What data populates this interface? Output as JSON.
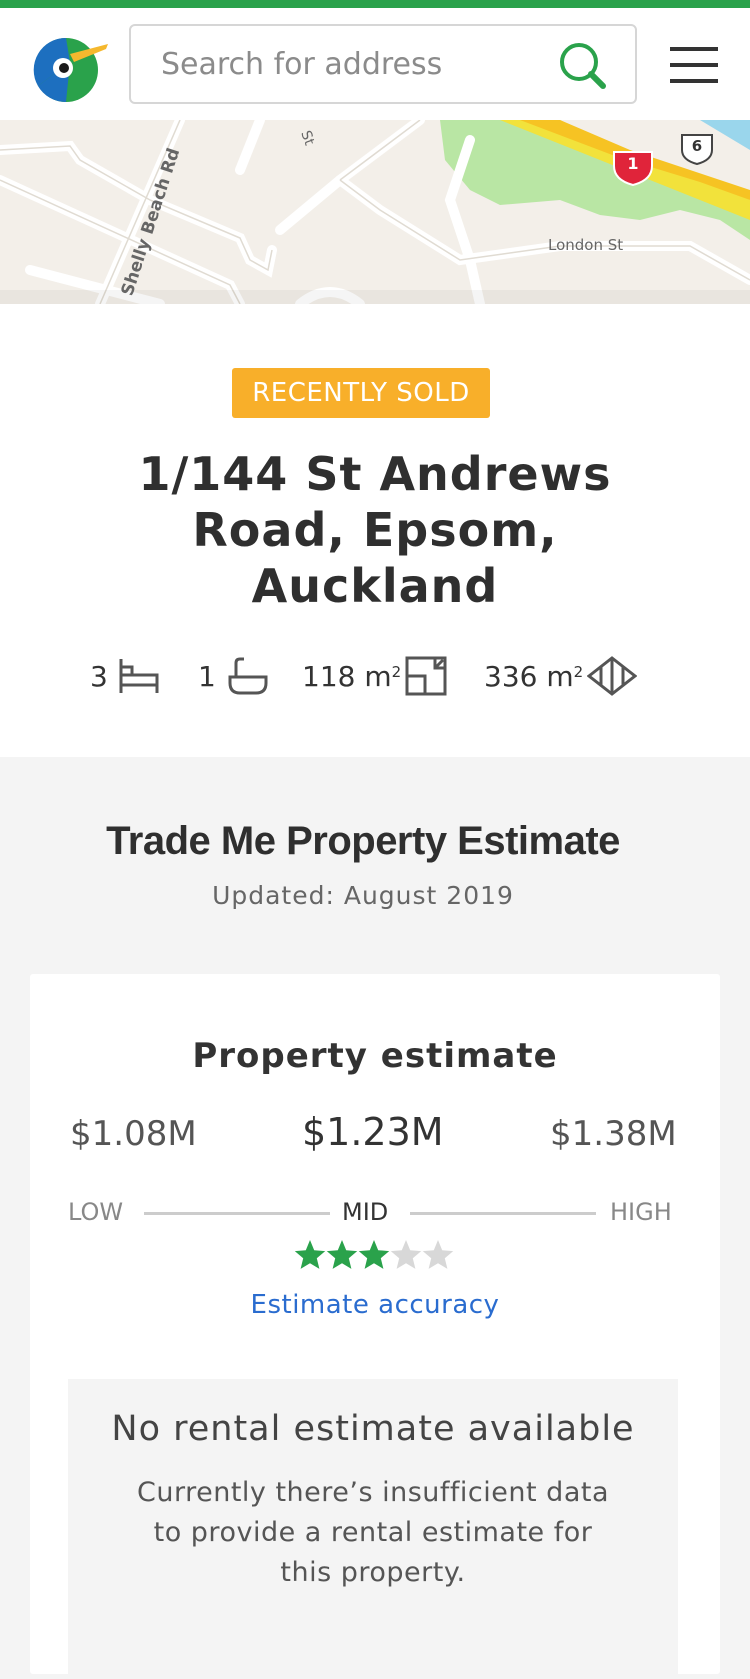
{
  "colors": {
    "brand_green": "#2aa24b",
    "badge_orange": "#f8af2a",
    "link_blue": "#2a6ccf",
    "star_filled": "#2aa24b",
    "star_empty": "#d8d8d8"
  },
  "header": {
    "logo_icon": "kiwi-bird-logo-icon",
    "search_placeholder": "Search for address",
    "search_icon": "search-icon",
    "menu_icon": "hamburger-menu-icon"
  },
  "map": {
    "labels": {
      "shelly_beach": "Shelly Beach Rd",
      "london": "London St",
      "st_fragment": "St"
    },
    "route_badges": {
      "state_highway": "1",
      "route": "6"
    }
  },
  "property": {
    "badge": "RECENTLY SOLD",
    "address": "1/144 St Andrews Road, Epsom, Auckland",
    "bedrooms": "3",
    "bathrooms": "1",
    "floor_area": "118 m",
    "land_area": "336 m",
    "area_unit_sup": "2",
    "icons": {
      "bed": "bed-icon",
      "bath": "bath-icon",
      "floor": "floor-plan-icon",
      "land": "land-area-icon"
    }
  },
  "estimate": {
    "section_title": "Trade Me Property Estimate",
    "updated": "Updated: August 2019",
    "card_title": "Property estimate",
    "low_value": "$1.08M",
    "mid_value": "$1.23M",
    "high_value": "$1.38M",
    "low_label": "LOW",
    "mid_label": "MID",
    "high_label": "HIGH",
    "accuracy_rating": 3,
    "accuracy_max": 5,
    "accuracy_link": "Estimate accuracy"
  },
  "rental": {
    "title": "No rental estimate available",
    "text": "Currently there’s insufficient data to provide a rental estimate for this property."
  }
}
